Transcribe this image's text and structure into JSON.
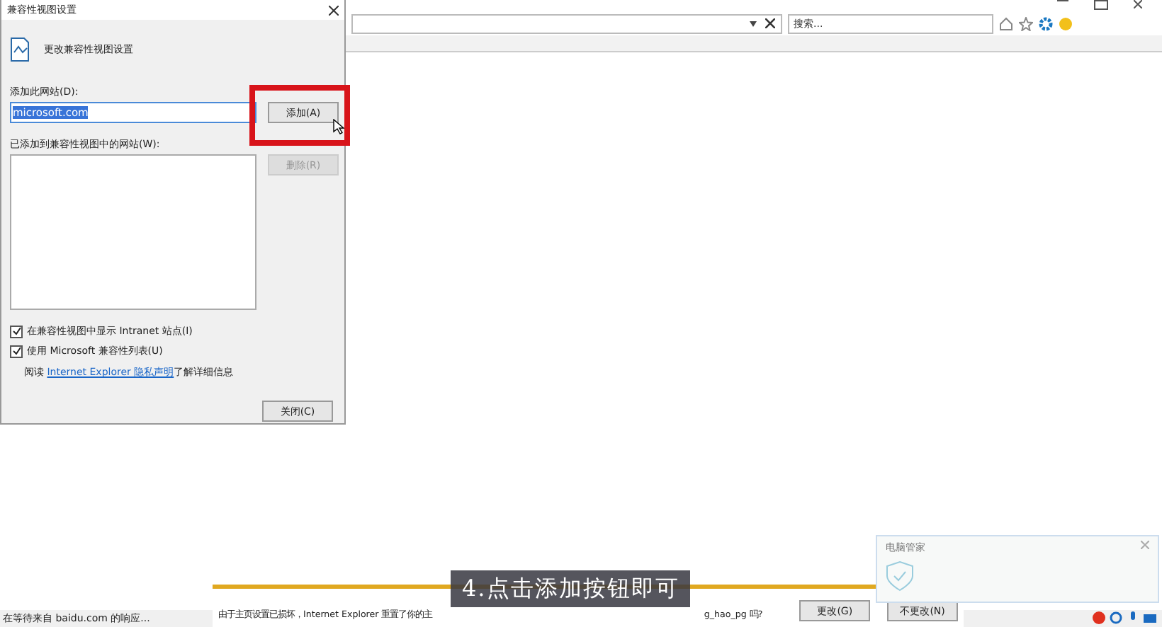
{
  "browser": {
    "search": {
      "placeholder": "搜索..."
    },
    "status_text": "在等待来自 baidu.com 的响应..."
  },
  "dialog": {
    "title": "兼容性视图设置",
    "heading": "更改兼容性视图设置",
    "add_label": "添加此网站(D):",
    "add_value": "microsoft.com",
    "add_button": "添加(A)",
    "list_label": "已添加到兼容性视图中的网站(W):",
    "remove_button": {
      "label": "删除(R)",
      "disabled": true
    },
    "options": [
      {
        "label": "在兼容性视图中显示 Intranet 站点(I)",
        "checked": true
      },
      {
        "label": "使用 Microsoft 兼容性列表(U)",
        "checked": true
      }
    ],
    "info_prefix": "阅读 ",
    "info_link": "Internet Explorer 隐私声明",
    "info_suffix": "了解详细信息",
    "close_button": "关闭(C)"
  },
  "notification_bar": {
    "text_start": "由于主页设置已损坏，Internet Explorer 重置了你的主",
    "text_end": "g_hao_pg 吗?",
    "buttons": [
      "更改(G)",
      "不更改(N)"
    ]
  },
  "security_popup": {
    "title": "电脑管家"
  },
  "caption": "4.点击添加按钮即可"
}
